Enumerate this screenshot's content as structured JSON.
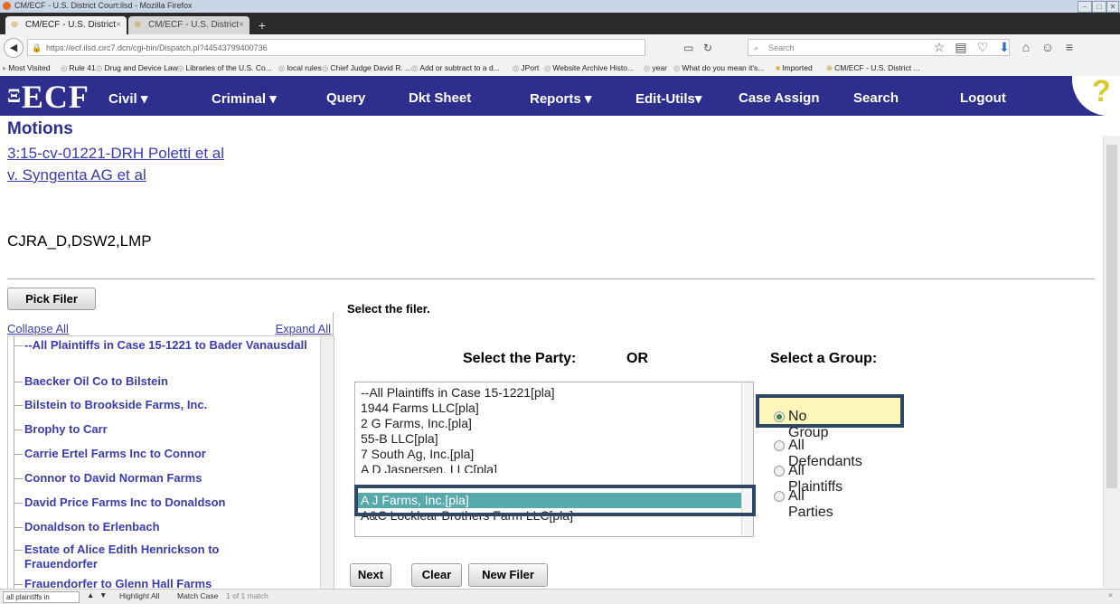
{
  "window": {
    "title": "CM/ECF - U.S. District Court:ilsd - Mozilla Firefox"
  },
  "tabs": [
    {
      "label": "CM/ECF - U.S. District Cour..."
    },
    {
      "label": "CM/ECF - U.S. District Cour..."
    }
  ],
  "nav": {
    "url": "https://ecf.ilsd.circ7.dcn/cgi-bin/Dispatch.pl?44543799400736",
    "search_placeholder": "Search"
  },
  "bookmarks": [
    "Most Visited",
    "Rule 41",
    "Drug and Device Law",
    "Libraries of the U.S. Co...",
    "local rules",
    "Chief Judge David R. ...",
    "Add or subtract to a d...",
    "JPort",
    "Website Archive Histo...",
    "year",
    "What do you mean it's...",
    "Imported",
    "CM/ECF - U.S. District ..."
  ],
  "ecf": {
    "logo": "ECF",
    "menu": [
      "Civil",
      "Criminal",
      "Query",
      "Dkt Sheet",
      "Reports",
      "Edit-Utils",
      "Case Assign",
      "Search",
      "Logout"
    ],
    "help": "?"
  },
  "page": {
    "title": "Motions",
    "case_line1": "3:15-cv-01221-DRH Poletti et al",
    "case_line2": "v. Syngenta AG et al",
    "cjra": "CJRA_D,DSW2,LMP"
  },
  "left_pane": {
    "pick_filer": "Pick Filer",
    "collapse_all": "Collapse All",
    "expand_all": "Expand All",
    "items": [
      "--All Plaintiffs in Case 15-1221 to Bader Vanausdall",
      "Baecker Oil Co to Bilstein",
      "Bilstein to Brookside Farms, Inc.",
      "Brophy to Carr",
      "Carrie Ertel Farms Inc to Connor",
      "Connor to David Norman Farms",
      "David Price Farms Inc to Donaldson",
      "Donaldson to Erlenbach",
      "Estate of Alice Edith Henrickson to Frauendorfer",
      "Frauendorfer to Glenn Hall Farms"
    ]
  },
  "right_pane": {
    "select_filer": "Select the filer.",
    "select_party": "Select the Party:",
    "or": "OR",
    "select_group": "Select a Group:",
    "parties": [
      "--All Plaintiffs in Case 15-1221[pla]",
      "1944 Farms LLC[pla]",
      "2 G Farms, Inc.[pla]",
      "55-B LLC[pla]",
      "7 South Ag, Inc.[pla]",
      "A D Jaspersen, LLC[pla]",
      "A J Farms, Inc.[pla]",
      "A&C Locklear Brothers Farm LLC[pla]"
    ],
    "selected_party": "A J Farms, Inc.[pla]",
    "groups": [
      "No Group",
      "All Defendants",
      "All Plaintiffs",
      "All Parties"
    ],
    "selected_group": "No Group",
    "buttons": {
      "next": "Next",
      "clear": "Clear",
      "new_filer": "New Filer"
    }
  },
  "findbar": {
    "query": "all plaintiffs in",
    "highlight_all": "Highlight All",
    "match_case": "Match Case",
    "result": "1 of 1 match"
  },
  "colors": {
    "ecf_bar": "#2e2e8f",
    "link": "#3b3bb0",
    "selected_row": "#58a9ac",
    "highlight_box": "#2e4766",
    "radio_highlight": "#fdf6b8"
  }
}
